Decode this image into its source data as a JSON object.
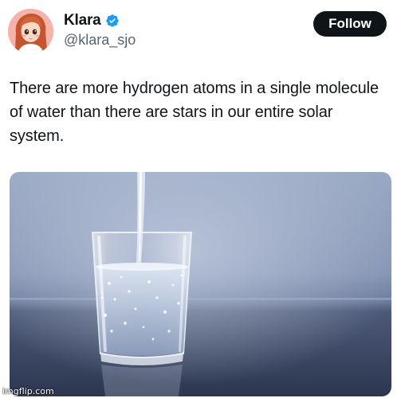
{
  "author": {
    "display_name": "Klara",
    "handle": "@klara_sjo",
    "verified": true,
    "verified_color": "#1d9bf0"
  },
  "actions": {
    "follow_label": "Follow"
  },
  "tweet": {
    "text": "There are more hydrogen atoms in a single molecule of water than there are stars in our entire solar system."
  },
  "media": {
    "image": "glass-of-water-being-poured-photo"
  },
  "watermark": {
    "text": "imgflip.com"
  }
}
